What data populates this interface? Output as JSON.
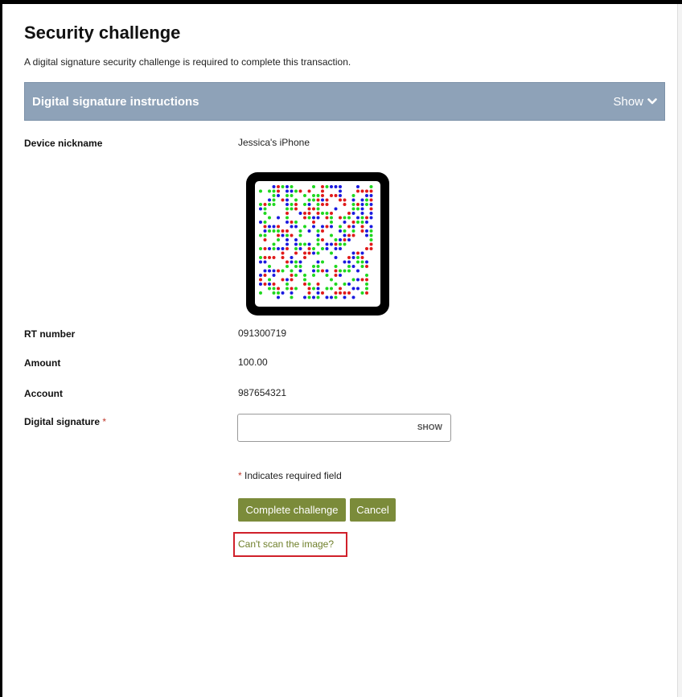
{
  "page": {
    "title": "Security challenge",
    "subtitle": "A digital signature security challenge is required to complete this transaction."
  },
  "instructions": {
    "title": "Digital signature instructions",
    "toggle_label": "Show",
    "toggle_icon": "chevron-down-icon"
  },
  "fields": {
    "device_nickname": {
      "label": "Device nickname",
      "value": "Jessica's iPhone"
    },
    "rt_number": {
      "label": "RT number",
      "value": "091300719"
    },
    "amount": {
      "label": "Amount",
      "value": "100.00"
    },
    "account": {
      "label": "Account",
      "value": "987654321"
    },
    "digital_signature": {
      "label": "Digital signature",
      "required_marker": "*",
      "value": "",
      "show_label": "SHOW"
    }
  },
  "required_note": {
    "marker": "*",
    "text": " Indicates required field"
  },
  "buttons": {
    "complete": "Complete challenge",
    "cancel": "Cancel"
  },
  "links": {
    "cant_scan": "Can't scan the image?"
  },
  "colors": {
    "instructions_bar": "#8ea2b8",
    "button": "#7b8b3a",
    "link": "#6f7f2a",
    "highlight": "#d0202a",
    "required": "#c0392b",
    "qr_dot_colors": [
      "#1a1adf",
      "#e01a1a",
      "#1fd81f"
    ]
  },
  "qr_image": {
    "description_icon": "color-dot-signature-code"
  }
}
